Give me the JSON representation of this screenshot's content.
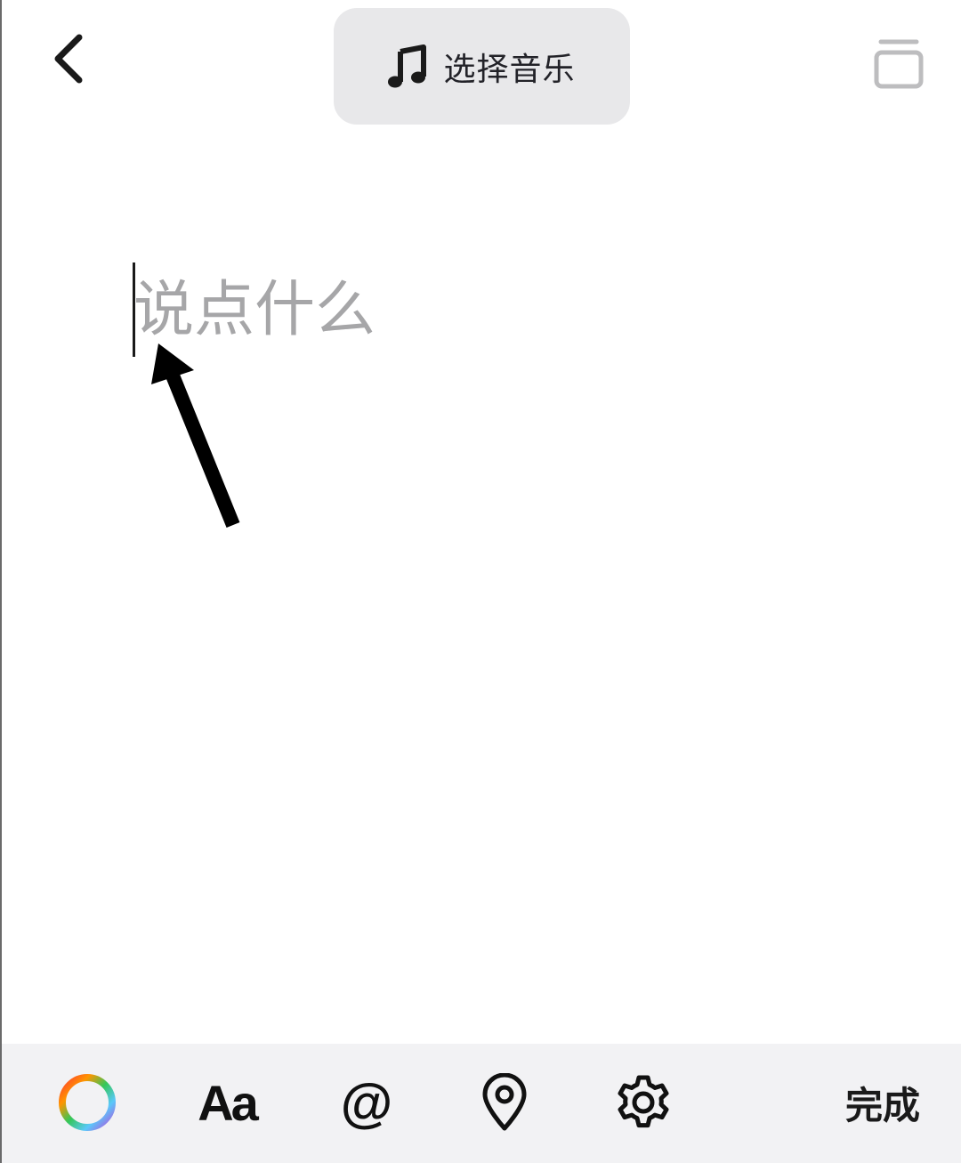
{
  "header": {
    "back_icon": "chevron-left-icon",
    "music_button_label": "选择音乐",
    "music_icon": "music-note-icon",
    "right_icon": "stack-icon"
  },
  "editor": {
    "placeholder": "说点什么",
    "value": ""
  },
  "toolbar": {
    "color_icon": "color-wheel-icon",
    "font_label": "Aa",
    "mention_label": "@",
    "location_icon": "location-pin-icon",
    "settings_icon": "gear-icon",
    "done_label": "完成"
  },
  "colors": {
    "music_button_bg": "#e8e8ea",
    "toolbar_bg": "#f2f2f4",
    "placeholder": "#a6a6a8",
    "icon_dark": "#1a1a1a"
  }
}
